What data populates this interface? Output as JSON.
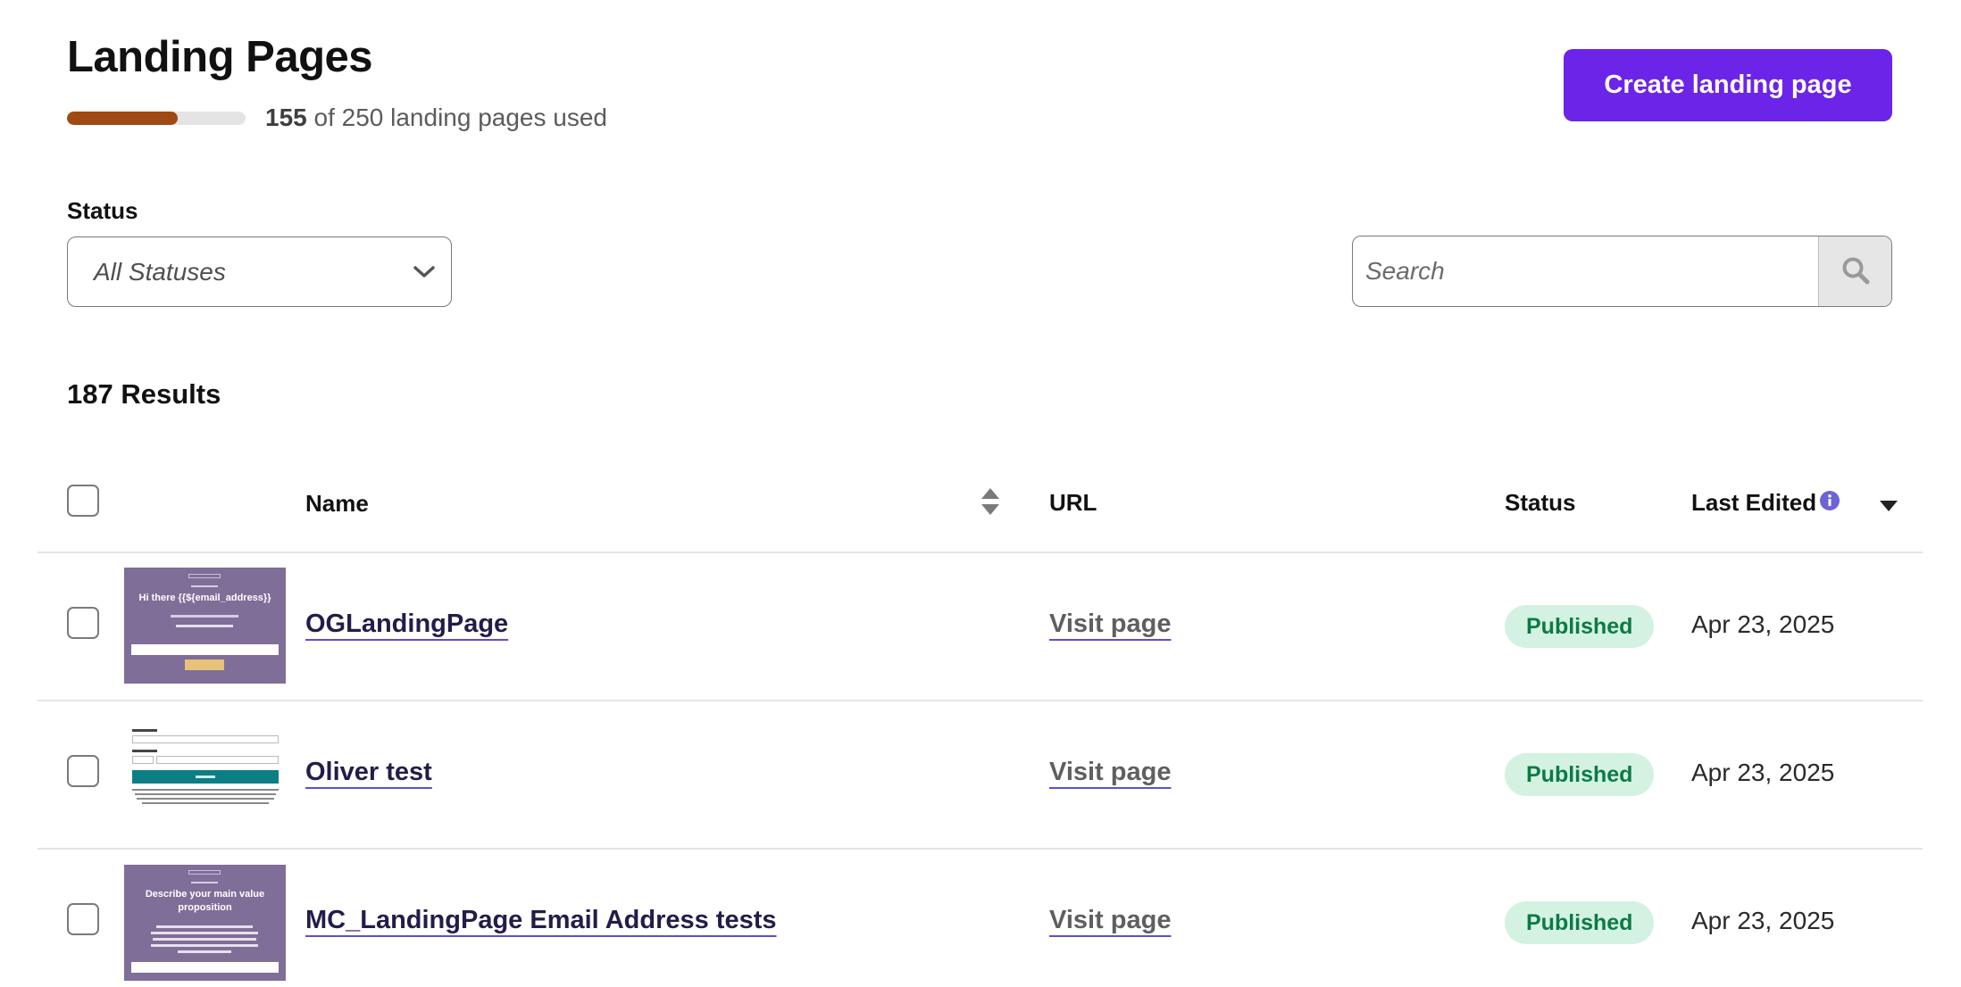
{
  "header": {
    "title": "Landing Pages",
    "usage_used": "155",
    "usage_text": "of 250 landing pages used",
    "usage_fraction": 0.62,
    "usage_color": "#9e4a12",
    "create_button": "Create landing page",
    "accent": "#6c24e8"
  },
  "filters": {
    "status_label": "Status",
    "status_value": "All Statuses",
    "search_placeholder": "Search"
  },
  "results": "187 Results",
  "table": {
    "headers": {
      "name": "Name",
      "url": "URL",
      "status": "Status",
      "last_edited": "Last Edited"
    },
    "rows": [
      {
        "name": "OGLandingPage",
        "url_label": "Visit page",
        "status": "Published",
        "last_edited": "Apr 23, 2025",
        "thumb": {
          "headline": "Hi there {{${email_address}}"
        }
      },
      {
        "name": "Oliver test",
        "url_label": "Visit page",
        "status": "Published",
        "last_edited": "Apr 23, 2025",
        "thumb": {
          "headline": ""
        }
      },
      {
        "name": "MC_LandingPage Email Address tests",
        "url_label": "Visit page",
        "status": "Published",
        "last_edited": "Apr 23, 2025",
        "thumb": {
          "headline": "Describe your main value proposition"
        }
      }
    ]
  }
}
